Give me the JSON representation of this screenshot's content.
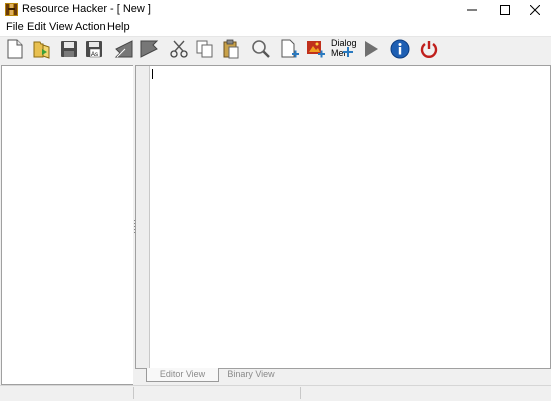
{
  "window": {
    "title": "Resource Hacker - [ New ]",
    "controls": [
      "minimize",
      "maximize",
      "close"
    ]
  },
  "menu": {
    "items": [
      "File",
      "Edit",
      "View",
      "Action",
      "Help"
    ]
  },
  "toolbar": {
    "buttons": [
      {
        "id": "new",
        "icon": "new-file-icon"
      },
      {
        "id": "open",
        "icon": "open-folder-icon"
      },
      {
        "id": "save",
        "icon": "save-icon"
      },
      {
        "id": "save-as",
        "icon": "save-as-icon"
      },
      {
        "id": "back",
        "icon": "back-arrow-icon"
      },
      {
        "id": "forward",
        "icon": "forward-arrow-icon"
      },
      {
        "id": "cut",
        "icon": "cut-icon"
      },
      {
        "id": "copy",
        "icon": "copy-icon"
      },
      {
        "id": "paste",
        "icon": "paste-icon"
      },
      {
        "id": "find",
        "icon": "search-icon"
      },
      {
        "id": "add-blank",
        "icon": "add-blank-resource-icon"
      },
      {
        "id": "add-image",
        "icon": "add-image-resource-icon"
      },
      {
        "id": "dialog-menu",
        "icon": "dialog-menu-icon",
        "label_line1": "Dialog",
        "label_line2": "Mer"
      },
      {
        "id": "compile",
        "icon": "play-icon"
      },
      {
        "id": "about",
        "icon": "info-icon"
      },
      {
        "id": "exit",
        "icon": "power-icon"
      }
    ],
    "dialog_label_1": "Dialog",
    "dialog_label_2": "Mer"
  },
  "editor": {
    "tabs": {
      "editor_view": "Editor View",
      "binary_view": "Binary View"
    },
    "active_tab": "Editor View",
    "content": ""
  },
  "statusbar": {
    "segments": [
      "",
      "",
      ""
    ]
  },
  "colors": {
    "chrome_bg": "#f0f0f0",
    "pane_border": "#a0a0a0",
    "tab_text": "#8a8a8a",
    "exit_red": "#c0201d",
    "info_blue": "#1e5fb3",
    "play_gray": "#707070"
  }
}
